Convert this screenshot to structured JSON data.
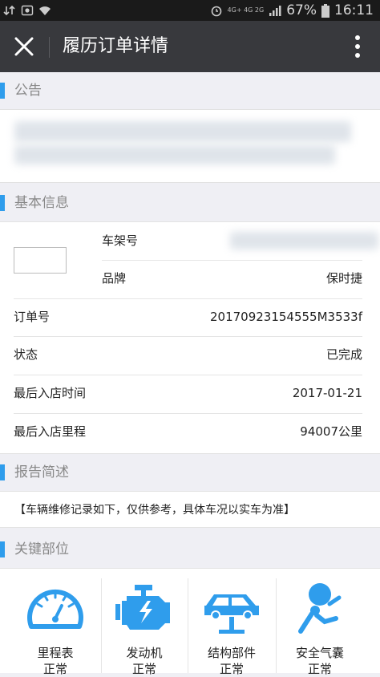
{
  "status_bar": {
    "battery": "67%",
    "time": "16:11",
    "network": "4G+ 4G 2G"
  },
  "titlebar": {
    "title": "履历订单详情"
  },
  "sections": {
    "notice": "公告",
    "basic": "基本信息",
    "report": "报告简述",
    "key_parts": "关键部位"
  },
  "basic_info": {
    "vin_label": "车架号",
    "brand_label": "品牌",
    "brand_value": "保时捷",
    "order_label": "订单号",
    "order_value": "20170923154555M3533f",
    "status_label": "状态",
    "status_value": "已完成",
    "last_visit_label": "最后入店时间",
    "last_visit_value": "2017-01-21",
    "mileage_label": "最后入店里程",
    "mileage_value": "94007公里"
  },
  "report_text": "【车辆维修记录如下，仅供参考，具体车况以实车为准】",
  "key_parts": [
    {
      "name": "里程表",
      "status": "正常",
      "icon": "speedometer-icon"
    },
    {
      "name": "发动机",
      "status": "正常",
      "icon": "engine-icon"
    },
    {
      "name": "结构部件",
      "status": "正常",
      "icon": "car-lift-icon"
    },
    {
      "name": "安全气囊",
      "status": "正常",
      "icon": "airbag-icon"
    }
  ],
  "colors": {
    "accent": "#2f9dec",
    "titlebar": "#38393d",
    "statusbar": "#1a1a1a"
  }
}
